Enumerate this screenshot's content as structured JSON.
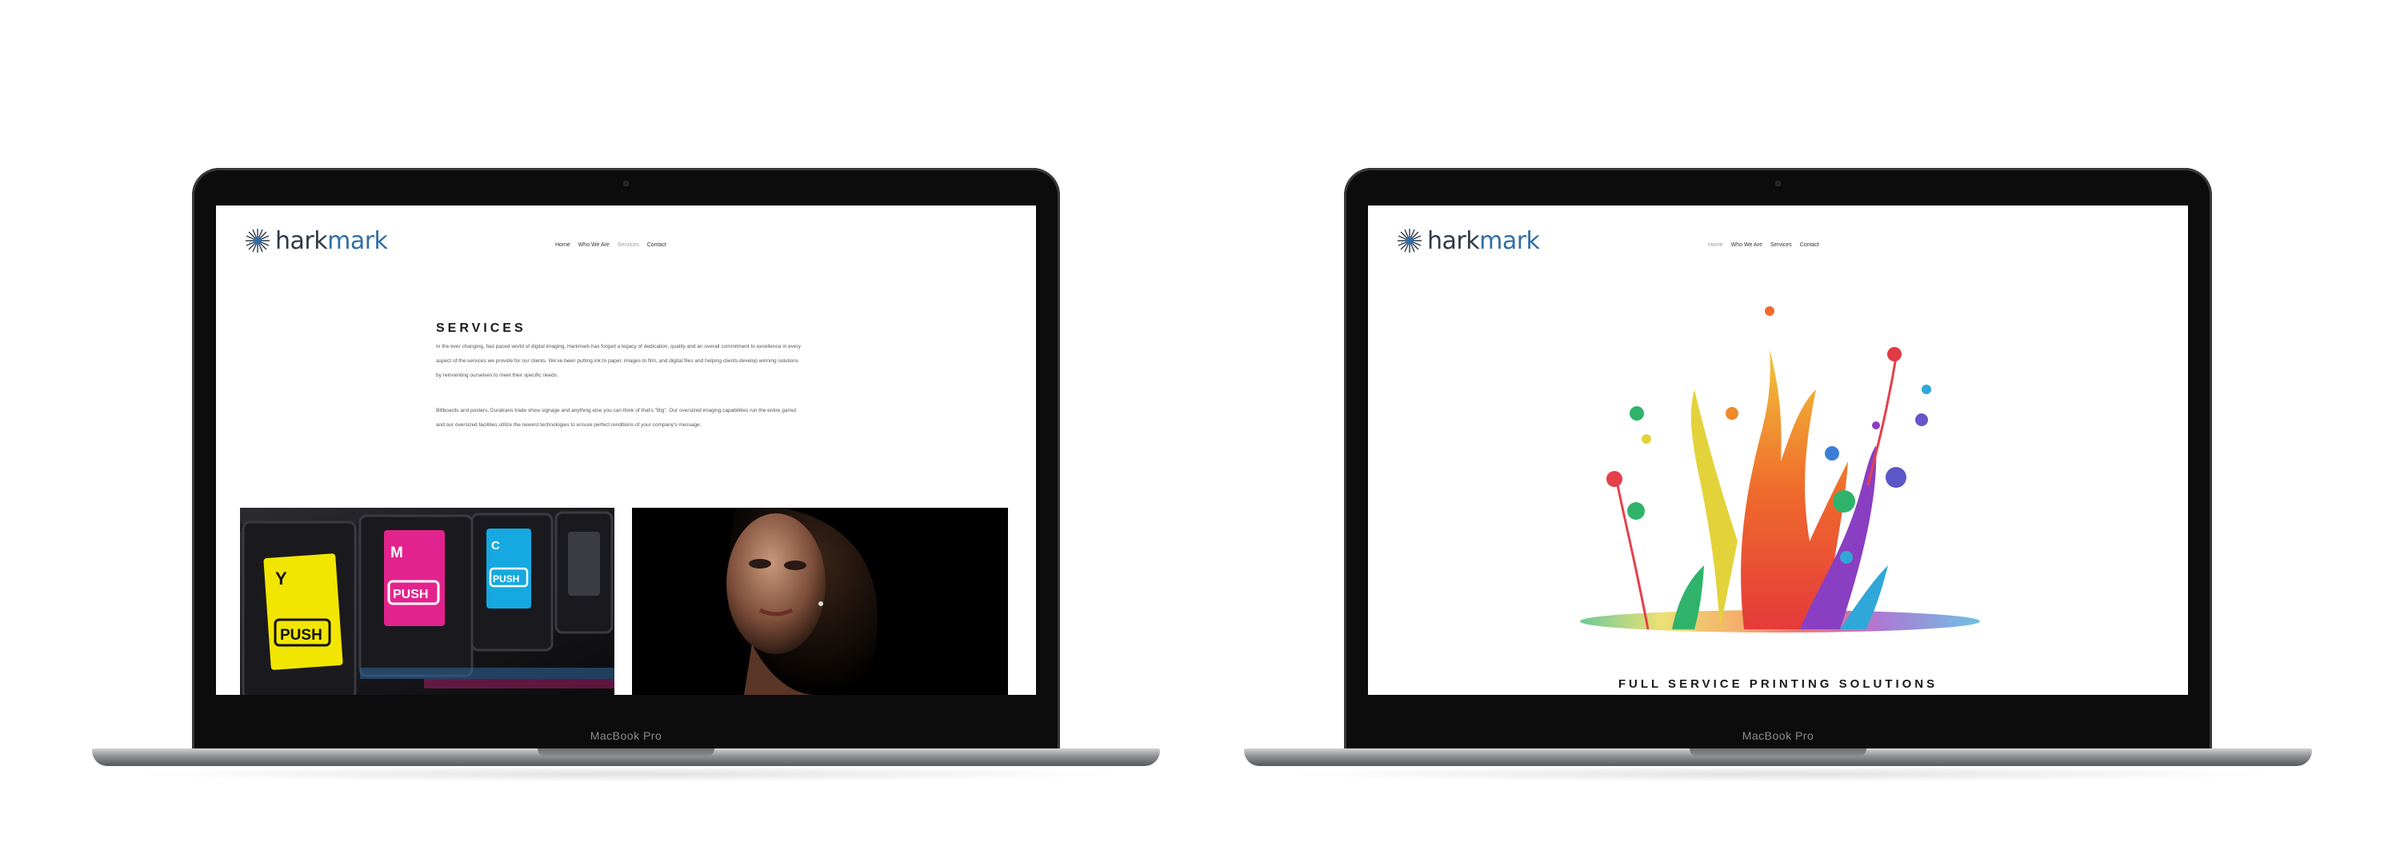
{
  "device": {
    "model_label": "MacBook Pro"
  },
  "site": {
    "logo": {
      "part1": "hark",
      "part2": "mark",
      "mark_color": "#2f6ea5",
      "text_color": "#2f3a48"
    },
    "nav": [
      "Home",
      "Who We Are",
      "Services",
      "Contact"
    ]
  },
  "left_screen": {
    "active_nav": "Services",
    "heading": "SERVICES",
    "paragraphs": [
      "In the ever changing, fast paced world of digital imaging, Harkmark has forged a legacy of dedication, quality and an overall commitment to excellence in every aspect of the services we provide for our clients. We've been putting ink to paper, images to film, and digital files and helping clients develop winning solutions by reinventing ourselves to meet their specific needs.",
      "Billboards and posters, Duratrans trade show signage and anything else you can think of that's \"Big\". Our oversized imaging capabilities run the entire gamut and our oversized facilities utilize the newest technologies to ensure perfect renditions of your company's message."
    ],
    "images": [
      {
        "name": "ink-cartridges-photo",
        "cartridges": [
          {
            "label": "Y",
            "button": "PUSH",
            "color": "#f2e600"
          },
          {
            "label": "M",
            "button": "PUSH",
            "color": "#e2238d"
          },
          {
            "label": "C",
            "button": "PUSH",
            "color": "#16a9e1"
          }
        ]
      },
      {
        "name": "portrait-photo"
      }
    ]
  },
  "right_screen": {
    "active_nav": "Home",
    "tagline": "FULL SERVICE PRINTING SOLUTIONS"
  }
}
